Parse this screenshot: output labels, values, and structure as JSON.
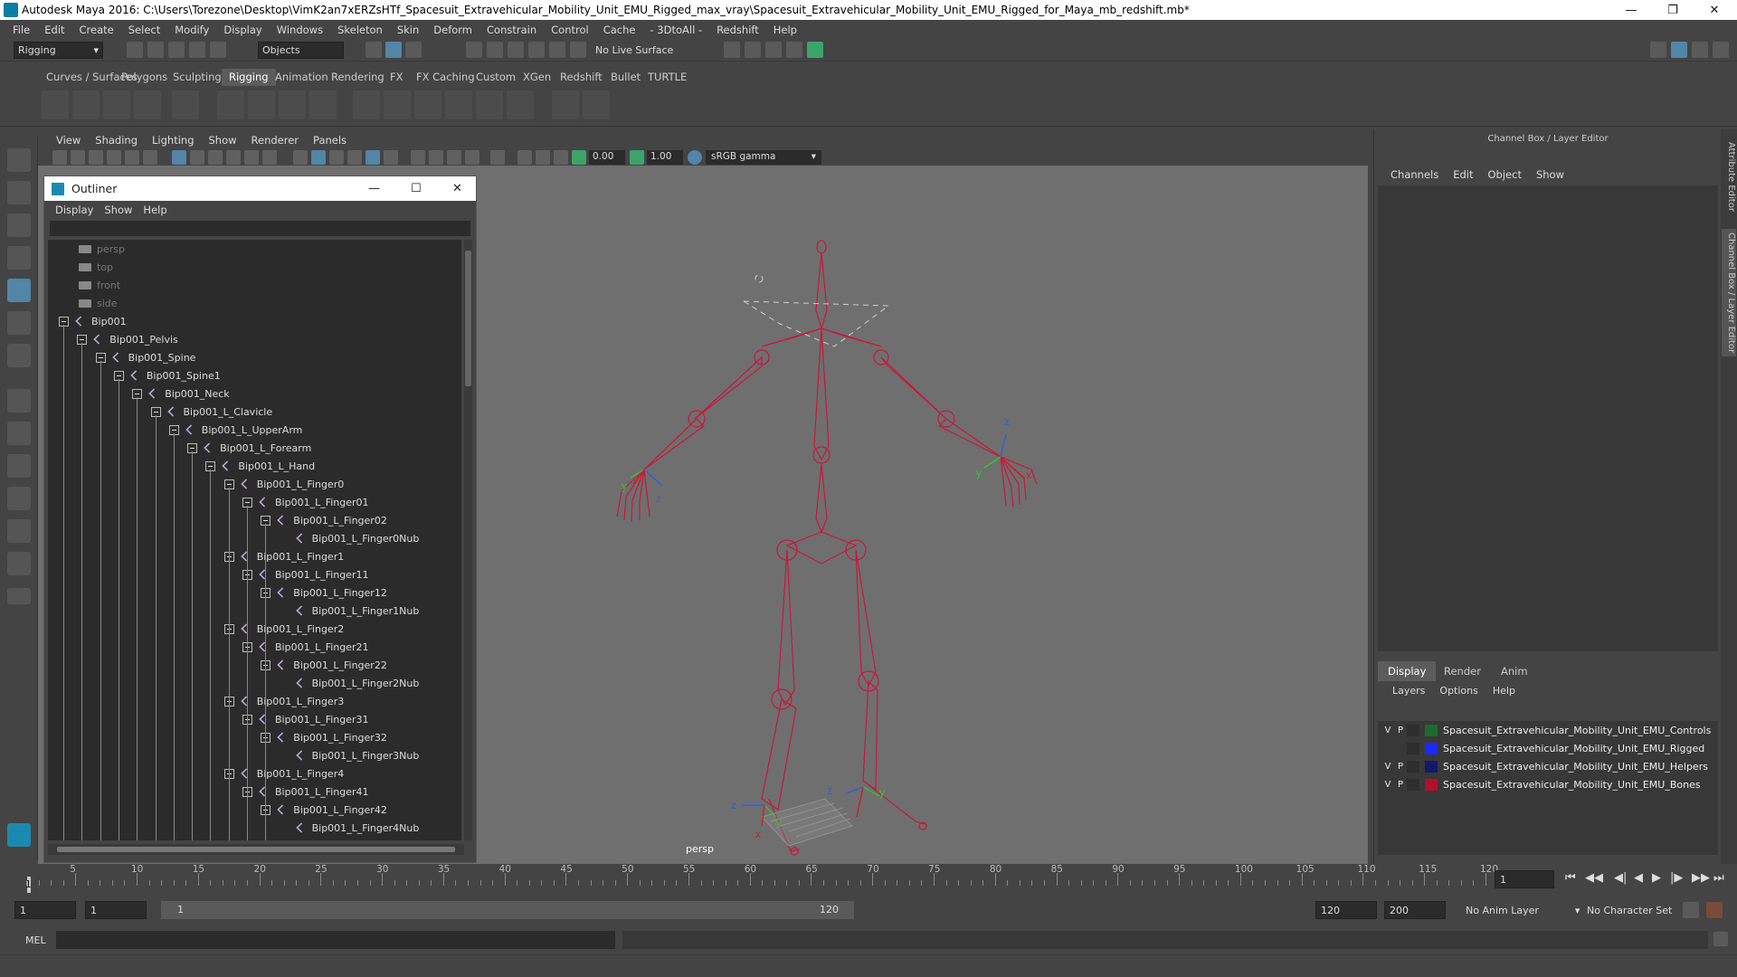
{
  "window": {
    "title": "Autodesk Maya 2016: C:\\Users\\Torezone\\Desktop\\VimK2an7xERZsHTf_Spacesuit_Extravehicular_Mobility_Unit_EMU_Rigged_max_vray\\Spacesuit_Extravehicular_Mobility_Unit_EMU_Rigged_for_Maya_mb_redshift.mb*"
  },
  "menubar": [
    "File",
    "Edit",
    "Create",
    "Select",
    "Modify",
    "Display",
    "Windows",
    "Skeleton",
    "Skin",
    "Deform",
    "Constrain",
    "Control",
    "Cache",
    "- 3DtoAll -",
    "Redshift",
    "Help"
  ],
  "statusline": {
    "menuset": "Rigging",
    "objects": "Objects",
    "live_surface": "No Live Surface"
  },
  "shelf_tabs": [
    "Curves / Surfaces",
    "Polygons",
    "Sculpting",
    "Rigging",
    "Animation",
    "Rendering",
    "FX",
    "FX Caching",
    "Custom",
    "XGen",
    "Redshift",
    "Bullet",
    "TURTLE"
  ],
  "active_shelf": "Rigging",
  "viewport": {
    "menu": [
      "View",
      "Shading",
      "Lighting",
      "Show",
      "Renderer",
      "Panels"
    ],
    "exposure": "0.00",
    "gamma": "1.00",
    "colorspace": "sRGB gamma",
    "camera": "persp"
  },
  "outliner": {
    "title": "Outliner",
    "menu": [
      "Display",
      "Show",
      "Help"
    ],
    "items": [
      {
        "label": "persp",
        "depth": 0,
        "type": "camera"
      },
      {
        "label": "top",
        "depth": 0,
        "type": "camera"
      },
      {
        "label": "front",
        "depth": 0,
        "type": "camera"
      },
      {
        "label": "side",
        "depth": 0,
        "type": "camera"
      },
      {
        "label": "Bip001",
        "depth": 0,
        "type": "joint"
      },
      {
        "label": "Bip001_Pelvis",
        "depth": 1,
        "type": "joint"
      },
      {
        "label": "Bip001_Spine",
        "depth": 2,
        "type": "joint"
      },
      {
        "label": "Bip001_Spine1",
        "depth": 3,
        "type": "joint"
      },
      {
        "label": "Bip001_Neck",
        "depth": 4,
        "type": "joint"
      },
      {
        "label": "Bip001_L_Clavicle",
        "depth": 5,
        "type": "joint"
      },
      {
        "label": "Bip001_L_UpperArm",
        "depth": 6,
        "type": "joint"
      },
      {
        "label": "Bip001_L_Forearm",
        "depth": 7,
        "type": "joint"
      },
      {
        "label": "Bip001_L_Hand",
        "depth": 8,
        "type": "joint"
      },
      {
        "label": "Bip001_L_Finger0",
        "depth": 9,
        "type": "joint"
      },
      {
        "label": "Bip001_L_Finger01",
        "depth": 10,
        "type": "joint"
      },
      {
        "label": "Bip001_L_Finger02",
        "depth": 11,
        "type": "joint"
      },
      {
        "label": "Bip001_L_Finger0Nub",
        "depth": 12,
        "type": "leaf"
      },
      {
        "label": "Bip001_L_Finger1",
        "depth": 9,
        "type": "joint"
      },
      {
        "label": "Bip001_L_Finger11",
        "depth": 10,
        "type": "joint"
      },
      {
        "label": "Bip001_L_Finger12",
        "depth": 11,
        "type": "joint"
      },
      {
        "label": "Bip001_L_Finger1Nub",
        "depth": 12,
        "type": "leaf"
      },
      {
        "label": "Bip001_L_Finger2",
        "depth": 9,
        "type": "joint"
      },
      {
        "label": "Bip001_L_Finger21",
        "depth": 10,
        "type": "joint"
      },
      {
        "label": "Bip001_L_Finger22",
        "depth": 11,
        "type": "joint"
      },
      {
        "label": "Bip001_L_Finger2Nub",
        "depth": 12,
        "type": "leaf"
      },
      {
        "label": "Bip001_L_Finger3",
        "depth": 9,
        "type": "joint"
      },
      {
        "label": "Bip001_L_Finger31",
        "depth": 10,
        "type": "joint"
      },
      {
        "label": "Bip001_L_Finger32",
        "depth": 11,
        "type": "joint"
      },
      {
        "label": "Bip001_L_Finger3Nub",
        "depth": 12,
        "type": "leaf"
      },
      {
        "label": "Bip001_L_Finger4",
        "depth": 9,
        "type": "joint"
      },
      {
        "label": "Bip001_L_Finger41",
        "depth": 10,
        "type": "joint"
      },
      {
        "label": "Bip001_L_Finger42",
        "depth": 11,
        "type": "joint"
      },
      {
        "label": "Bip001_L_Finger4Nub",
        "depth": 12,
        "type": "leaf"
      }
    ]
  },
  "channel_box": {
    "title": "Channel Box / Layer Editor",
    "menu": [
      "Channels",
      "Edit",
      "Object",
      "Show"
    ],
    "layer_tabs": [
      "Display",
      "Render",
      "Anim"
    ],
    "layer_menu": [
      "Layers",
      "Options",
      "Help"
    ],
    "layers": [
      {
        "v": "V",
        "p": "P",
        "color": "#1e6b2e",
        "name": "Spacesuit_Extravehicular_Mobility_Unit_EMU_Controls"
      },
      {
        "v": "",
        "p": "",
        "color": "#1a2aff",
        "name": "Spacesuit_Extravehicular_Mobility_Unit_EMU_Rigged"
      },
      {
        "v": "V",
        "p": "P",
        "color": "#101a6a",
        "name": "Spacesuit_Extravehicular_Mobility_Unit_EMU_Helpers"
      },
      {
        "v": "V",
        "p": "P",
        "color": "#b0102a",
        "name": "Spacesuit_Extravehicular_Mobility_Unit_EMU_Bones"
      }
    ],
    "side_tabs": [
      "Attribute Editor",
      "Channel Box / Layer Editor"
    ]
  },
  "timeline": {
    "ticks": [
      "5",
      "10",
      "15",
      "20",
      "25",
      "30",
      "35",
      "40",
      "45",
      "50",
      "55",
      "60",
      "65",
      "70",
      "75",
      "80",
      "85",
      "90",
      "95",
      "100",
      "105",
      "110",
      "115",
      "120"
    ],
    "current_frame": "1",
    "current_marker": "1"
  },
  "range": {
    "start": "1",
    "playback_start": "1",
    "slider_start": "1",
    "slider_end": "120",
    "playback_end": "120",
    "end": "200",
    "anim_layer": "No Anim Layer",
    "char_set": "No Character Set"
  },
  "cmdline": {
    "label": "MEL"
  },
  "colors": {
    "bone": "#c8183c",
    "accent": "#5285a6",
    "axis_x": "#d02020",
    "axis_y": "#2ec82e",
    "axis_z": "#3060e0"
  }
}
